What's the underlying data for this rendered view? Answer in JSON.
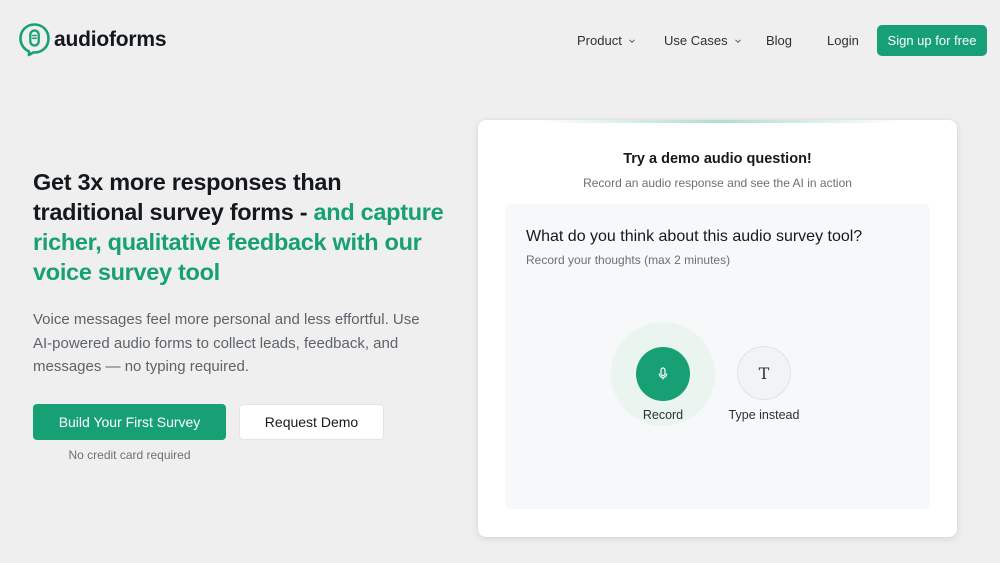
{
  "brand": {
    "name": "audioforms",
    "accent_color": "#16a074"
  },
  "nav": {
    "items": [
      {
        "label": "Product",
        "icon": "chevron-down-icon"
      },
      {
        "label": "Use Cases",
        "icon": "chevron-down-icon"
      },
      {
        "label": "Blog"
      },
      {
        "label": "Login"
      }
    ],
    "signup_label": "Sign up for free"
  },
  "hero": {
    "title_plain": "Get 3x more responses than traditional survey forms - ",
    "title_accent": "and capture richer, qualitative feedback with our voice survey tool",
    "description": "Voice messages feel more personal and less effortful. Use AI-powered audio forms to collect leads, feedback, and messages — no typing required.",
    "primary_cta": "Build Your First Survey",
    "secondary_cta": "Request Demo",
    "footnote": "No credit card required"
  },
  "demo": {
    "title": "Try a demo audio question!",
    "subtitle": "Record an audio response and see the AI in action",
    "question": "What do you think about this audio survey tool?",
    "hint": "Record your thoughts (max 2 minutes)",
    "record_label": "Record",
    "record_icon": "microphone-icon",
    "type_glyph": "T",
    "type_label": "Type instead"
  }
}
